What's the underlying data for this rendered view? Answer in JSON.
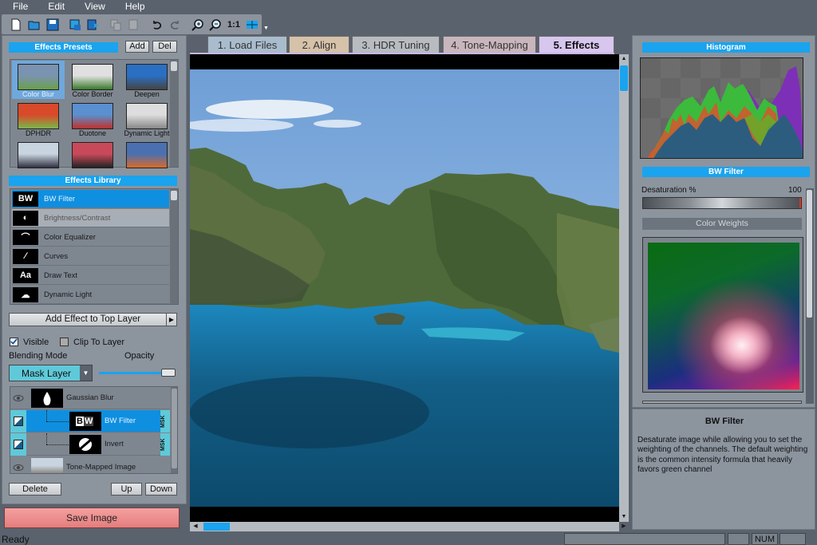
{
  "menu": [
    "File",
    "Edit",
    "View",
    "Help"
  ],
  "toolbar": {
    "icons": [
      "new-file-icon",
      "open-folder-icon",
      "save-icon",
      "save-copy-icon",
      "export-icon",
      "copy-icon",
      "paste-icon",
      "undo-icon",
      "redo-icon",
      "zoom-in-icon",
      "zoom-out-icon",
      "actual-size-icon",
      "fit-window-icon"
    ],
    "actual_size_label": "1:1"
  },
  "presets": {
    "title": "Effects Presets",
    "add_label": "Add",
    "del_label": "Del",
    "items": [
      {
        "label": "Color Blur",
        "selected": true,
        "colors": [
          "#7a93b0",
          "#6aa04a"
        ]
      },
      {
        "label": "Color Border",
        "colors": [
          "#e0e0e0",
          "#3a7a2a"
        ]
      },
      {
        "label": "Deepen",
        "colors": [
          "#2b6fc2",
          "#444"
        ]
      },
      {
        "label": "DPHDR",
        "colors": [
          "#d84a2a",
          "#7ab84a"
        ]
      },
      {
        "label": "Duotone",
        "colors": [
          "#5a90d0",
          "#c0302a"
        ]
      },
      {
        "label": "Dynamic Light",
        "colors": [
          "#ddd",
          "#888"
        ]
      },
      {
        "label": "",
        "colors": [
          "#c8d4e0",
          "#303040"
        ]
      },
      {
        "label": "",
        "colors": [
          "#c84a5a",
          "#222"
        ]
      },
      {
        "label": "",
        "colors": [
          "#4a70b0",
          "#d86a2a"
        ]
      }
    ]
  },
  "library": {
    "title": "Effects Library",
    "items": [
      {
        "label": "BW Filter",
        "icon": "bw-filter-icon",
        "glyph": "BW",
        "selected": true
      },
      {
        "label": "Brightness/Contrast",
        "icon": "brightness-contrast-icon",
        "glyph": "◐",
        "hover": true
      },
      {
        "label": "Color Equalizer",
        "icon": "color-equalizer-icon",
        "glyph": "⌒"
      },
      {
        "label": "Curves",
        "icon": "curves-icon",
        "glyph": "∕"
      },
      {
        "label": "Draw Text",
        "icon": "draw-text-icon",
        "glyph": "Aa"
      },
      {
        "label": "Dynamic Light",
        "icon": "dynamic-light-icon",
        "glyph": "☁"
      }
    ],
    "add_effect_label": "Add Effect to Top Layer"
  },
  "layer_options": {
    "visible_label": "Visible",
    "visible_checked": true,
    "clip_label": "Clip To Layer",
    "clip_checked": false,
    "blending_label": "Blending Mode",
    "opacity_label": "Opacity",
    "blending_value": "Mask Layer",
    "opacity_value": 1.0
  },
  "layers": [
    {
      "name": "Gaussian Blur",
      "icon": "eye-icon",
      "thumb": "drop-icon",
      "mask": false,
      "selected": false
    },
    {
      "name": "BW Filter",
      "icon": "mask-layer-icon",
      "thumb": "bw-filter-icon",
      "mask": true,
      "selected": true
    },
    {
      "name": "Invert",
      "icon": "mask-layer-icon",
      "thumb": "invert-icon",
      "mask": true,
      "selected": false
    },
    {
      "name": "Tone-Mapped Image",
      "icon": "eye-icon",
      "thumb": "photo-thumb",
      "mask": false,
      "selected": false
    }
  ],
  "layer_buttons": {
    "delete": "Delete",
    "up": "Up",
    "down": "Down"
  },
  "save_label": "Save Image",
  "msk_label": "MSK",
  "tabs": [
    {
      "label": "1. Load Files",
      "color": "#a9bccd"
    },
    {
      "label": "2. Align",
      "color": "#d6c2a8"
    },
    {
      "label": "3. HDR Tuning",
      "color": "#b8bcc0"
    },
    {
      "label": "4. Tone-Mapping",
      "color": "#c9b6bc"
    },
    {
      "label": "5. Effects",
      "color": "#d7c6ee",
      "active": true
    }
  ],
  "histogram": {
    "title": "Histogram"
  },
  "bw_filter": {
    "title": "BW Filter",
    "desaturation_label": "Desaturation %",
    "desaturation_value": "100",
    "color_weights_label": "Color Weights"
  },
  "description": {
    "title": "BW Filter",
    "text": "Desaturate image while allowing you to set the weighting of the channels. The default weighting is the common intensity formula that heavily favors green channel"
  },
  "status": {
    "ready": "Ready",
    "num": "NUM"
  }
}
